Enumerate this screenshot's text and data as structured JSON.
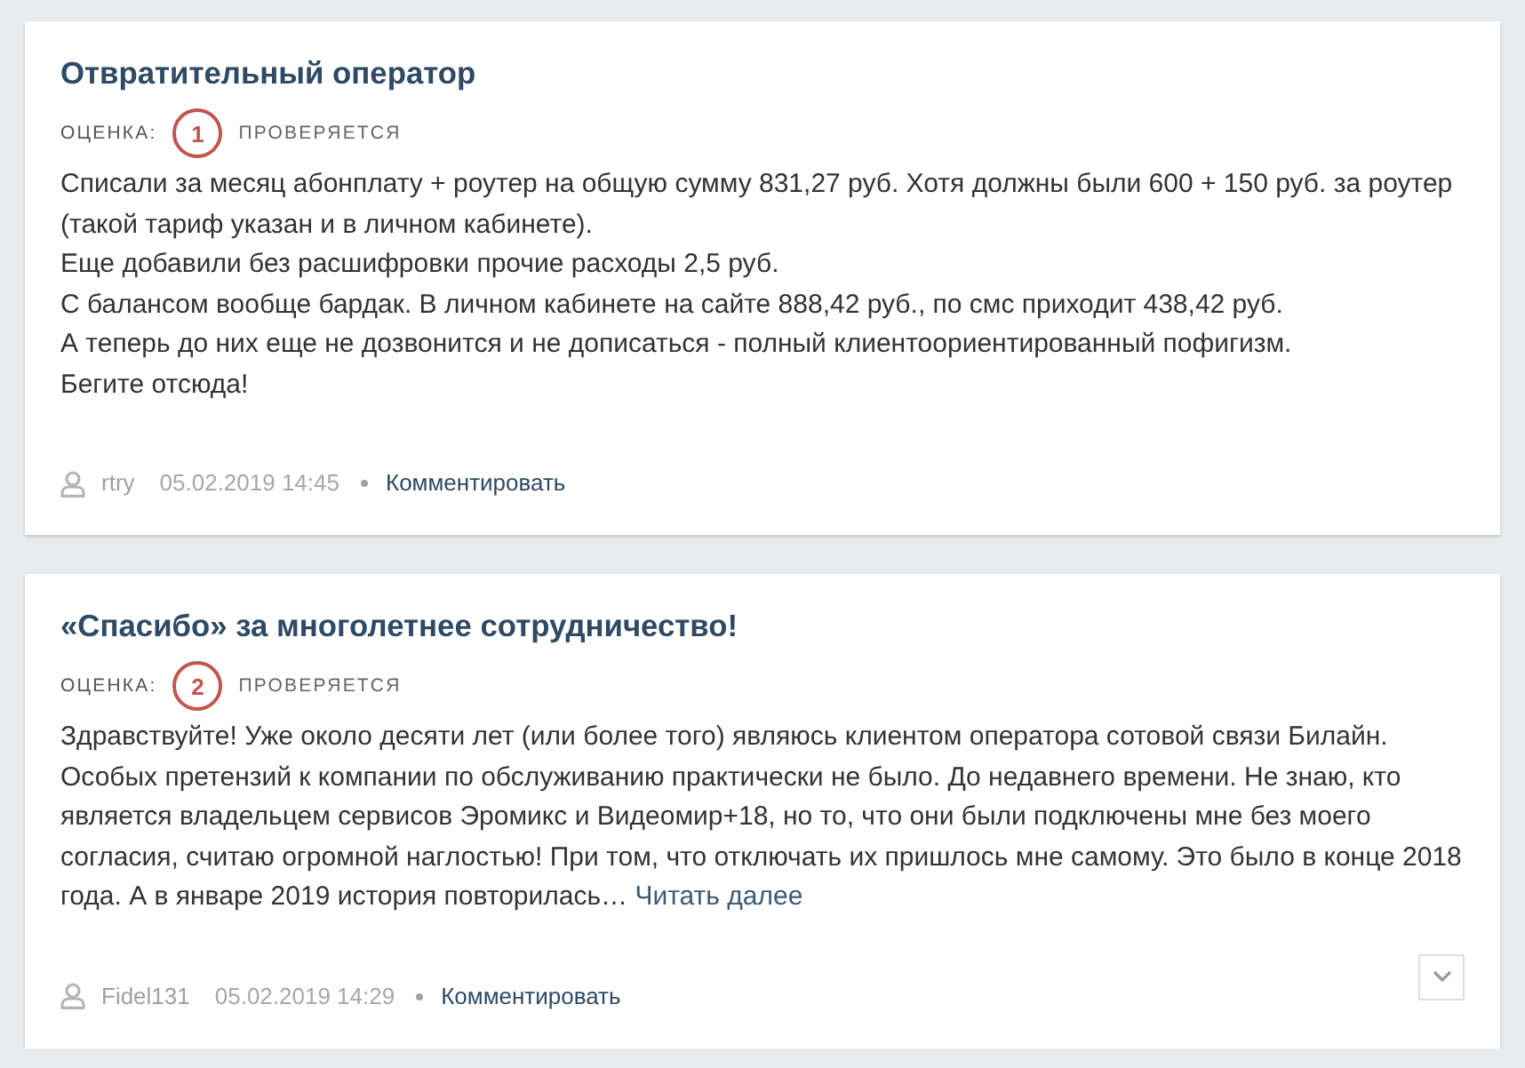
{
  "reviews": [
    {
      "title": "Отвратительный оператор",
      "rating_label": "ОЦЕНКА:",
      "rating": "1",
      "status": "ПРОВЕРЯЕТСЯ",
      "paragraphs": [
        "Списали за месяц абонплату + роутер на общую сумму 831,27 руб. Хотя должны были 600 + 150 руб. за роутер (такой тариф указан и в личном кабинете).",
        "Еще добавили без расшифровки прочие расходы 2,5 руб.",
        "С балансом вообще бардак. В личном кабинете на сайте 888,42 руб., по смс приходит 438,42 руб.",
        "А теперь до них еще не дозвонится и не дописаться - полный клиентоориентированный пофигизм.",
        "Бегите отсюда!"
      ],
      "author": "rtry",
      "date": "05.02.2019 14:45",
      "comment_link": "Комментировать",
      "expandable": false
    },
    {
      "title": "«Спасибо» за многолетнее сотрудничество!",
      "rating_label": "ОЦЕНКА:",
      "rating": "2",
      "status": "ПРОВЕРЯЕТСЯ",
      "paragraphs": [
        "Здравствуйте! Уже около десяти лет (или более того) являюсь клиентом оператора сотовой связи Билайн. Особых претензий к компании по обслуживанию практически не было. До недавнего времени. Не знаю, кто является владельцем сервисов Эромикс и Видеомир+18, но то, что они были подключены мне без моего согласия, считаю огромной наглостью! При том, что отключать их пришлось мне самому. Это было в конце 2018 года. А в январе 2019 история повторилась…"
      ],
      "read_more": "Читать далее",
      "author": "Fidel131",
      "date": "05.02.2019 14:29",
      "comment_link": "Комментировать",
      "expandable": true
    }
  ]
}
